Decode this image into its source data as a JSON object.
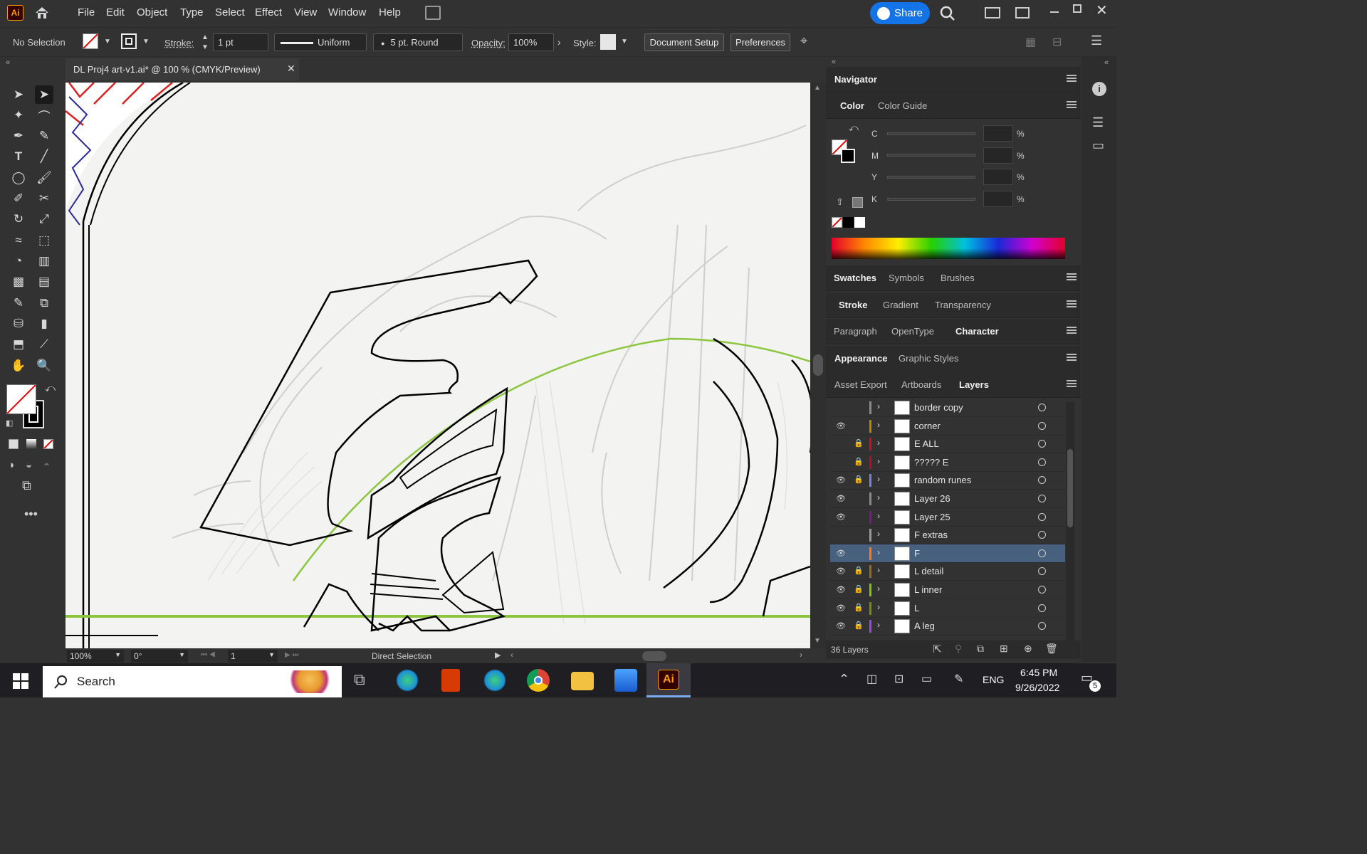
{
  "app": {
    "logo": "Ai",
    "share": "Share"
  },
  "menu": [
    "File",
    "Edit",
    "Object",
    "Type",
    "Select",
    "Effect",
    "View",
    "Window",
    "Help"
  ],
  "control": {
    "selection": "No Selection",
    "stroke_label": "Stroke:",
    "stroke_value": "1 pt",
    "profile": "Uniform",
    "brush": "5 pt. Round",
    "opacity_label": "Opacity:",
    "opacity_value": "100%",
    "style_label": "Style:",
    "doc_setup": "Document Setup",
    "preferences": "Preferences"
  },
  "document": {
    "tab_title": "DL Proj4 art-v1.ai* @ 100 % (CMYK/Preview)"
  },
  "status": {
    "zoom": "100%",
    "rotation": "0°",
    "artboard": "1",
    "tool": "Direct Selection"
  },
  "panels": {
    "navigator": "Navigator",
    "color_tabs": [
      "Color",
      "Color Guide"
    ],
    "cmyk": [
      {
        "label": "C",
        "value": ""
      },
      {
        "label": "M",
        "value": ""
      },
      {
        "label": "Y",
        "value": ""
      },
      {
        "label": "K",
        "value": ""
      }
    ],
    "pct": "%",
    "swatch_tabs": [
      "Swatches",
      "Symbols",
      "Brushes"
    ],
    "stroke_tabs": [
      "Stroke",
      "Gradient",
      "Transparency"
    ],
    "char_tabs": [
      "Paragraph",
      "OpenType",
      "Character"
    ],
    "appearance_tabs": [
      "Appearance",
      "Graphic Styles"
    ],
    "layer_tabs": [
      "Asset Export",
      "Artboards",
      "Layers"
    ]
  },
  "layers": {
    "count": "36 Layers",
    "items": [
      {
        "name": "border copy",
        "visible": false,
        "locked": false,
        "color": "#8a8a8a",
        "selected": false
      },
      {
        "name": "corner",
        "visible": true,
        "locked": false,
        "color": "#b8860b",
        "selected": false
      },
      {
        "name": "E ALL",
        "visible": false,
        "locked": true,
        "color": "#c0142b",
        "selected": false
      },
      {
        "name": "????? E",
        "visible": false,
        "locked": true,
        "color": "#b01020",
        "selected": false
      },
      {
        "name": "random runes",
        "visible": true,
        "locked": true,
        "color": "#8080e0",
        "selected": false
      },
      {
        "name": "Layer 26",
        "visible": true,
        "locked": false,
        "color": "#8a8a8a",
        "selected": false
      },
      {
        "name": "Layer 25",
        "visible": true,
        "locked": false,
        "color": "#7a1a8a",
        "selected": false
      },
      {
        "name": "F extras",
        "visible": false,
        "locked": false,
        "color": "#9a9a9a",
        "selected": false
      },
      {
        "name": "F",
        "visible": true,
        "locked": false,
        "color": "#ff7a1a",
        "selected": true
      },
      {
        "name": "L detail",
        "visible": true,
        "locked": true,
        "color": "#9b6a1a",
        "selected": false
      },
      {
        "name": "L inner",
        "visible": true,
        "locked": true,
        "color": "#7ac61a",
        "selected": false
      },
      {
        "name": "L",
        "visible": true,
        "locked": true,
        "color": "#7a8a1a",
        "selected": false
      },
      {
        "name": "A leg",
        "visible": true,
        "locked": true,
        "color": "#9a4ae0",
        "selected": false
      }
    ]
  },
  "taskbar": {
    "search": "Search",
    "time": "6:45 PM",
    "date": "9/26/2022",
    "lang": "ENG",
    "notif": "5"
  },
  "icons": [
    "home-icon",
    "search-icon",
    "arrange-icon",
    "selection-tool-icon",
    "direct-selection-icon",
    "pen-icon",
    "type-icon",
    "hand-icon",
    "zoom-icon",
    "eye-icon",
    "lock-icon",
    "windows-start-icon",
    "task-view-icon",
    "edge-icon",
    "office-icon",
    "chrome-icon",
    "file-explorer-icon",
    "photos-icon",
    "illustrator-icon"
  ]
}
